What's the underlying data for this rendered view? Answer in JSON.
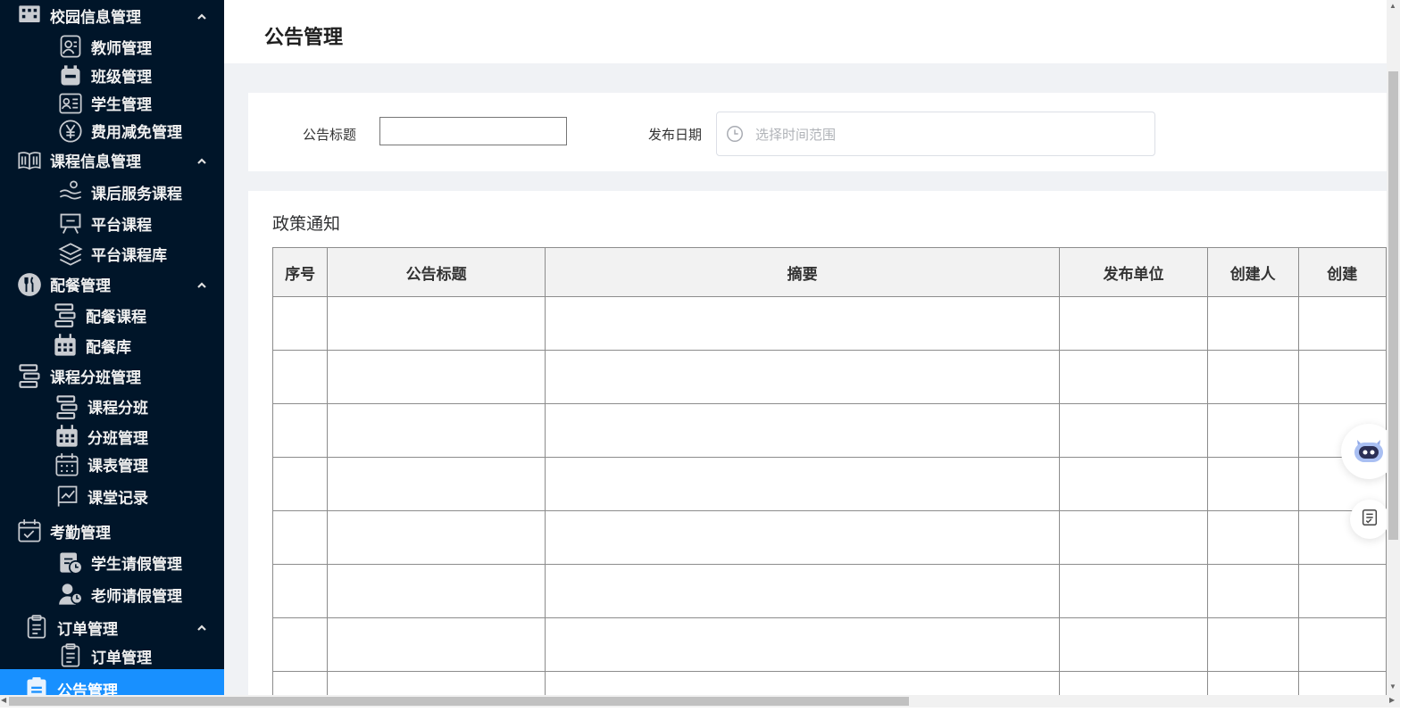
{
  "sidebar": {
    "items": [
      {
        "label": "校园信息管理",
        "icon": "building-icon",
        "level": 1,
        "expanded": true
      },
      {
        "label": "教师管理",
        "icon": "teacher-icon",
        "level": 2
      },
      {
        "label": "班级管理",
        "icon": "class-icon",
        "level": 2
      },
      {
        "label": "学生管理",
        "icon": "student-card-icon",
        "level": 2
      },
      {
        "label": "费用减免管理",
        "icon": "yen-coin-icon",
        "level": 2
      },
      {
        "label": "课程信息管理",
        "icon": "book-icon",
        "level": 1,
        "expanded": true
      },
      {
        "label": "课后服务课程",
        "icon": "service-icon",
        "level": 2
      },
      {
        "label": "平台课程",
        "icon": "presentation-icon",
        "level": 2
      },
      {
        "label": "平台课程库",
        "icon": "layers-icon",
        "level": 2
      },
      {
        "label": "配餐管理",
        "icon": "fork-knife-icon",
        "level": 1,
        "expanded": true
      },
      {
        "label": "配餐课程",
        "icon": "list-blocks-icon",
        "level": 2
      },
      {
        "label": "配餐库",
        "icon": "calendar-grid-icon",
        "level": 2
      },
      {
        "label": "课程分班管理",
        "icon": "list-blocks-icon",
        "level": 1
      },
      {
        "label": "课程分班",
        "icon": "list-blocks-icon",
        "level": 2
      },
      {
        "label": "分班管理",
        "icon": "calendar-grid-icon",
        "level": 2
      },
      {
        "label": "课表管理",
        "icon": "calendar-dots-icon",
        "level": 2
      },
      {
        "label": "课堂记录",
        "icon": "chart-board-icon",
        "level": 2
      },
      {
        "label": "考勤管理",
        "icon": "calendar-check-icon",
        "level": 1
      },
      {
        "label": "学生请假管理",
        "icon": "clipboard-clock-icon",
        "level": 2
      },
      {
        "label": "老师请假管理",
        "icon": "people-clock-icon",
        "level": 2
      },
      {
        "label": "订单管理",
        "icon": "clipboard-icon",
        "level": 1,
        "expanded": true
      },
      {
        "label": "订单管理",
        "icon": "clipboard-icon",
        "level": 2
      },
      {
        "label": "公告管理",
        "icon": "notice-icon",
        "level": 1,
        "active": true
      }
    ]
  },
  "page": {
    "title": "公告管理"
  },
  "filters": {
    "title_label": "公告标题",
    "title_value": "",
    "date_label": "发布日期",
    "date_placeholder": "选择时间范围"
  },
  "table": {
    "section_title": "政策通知",
    "columns": [
      "序号",
      "公告标题",
      "摘要",
      "发布单位",
      "创建人",
      "创建"
    ],
    "rows": [
      [
        "",
        "",
        "",
        "",
        "",
        ""
      ],
      [
        "",
        "",
        "",
        "",
        "",
        ""
      ],
      [
        "",
        "",
        "",
        "",
        "",
        ""
      ],
      [
        "",
        "",
        "",
        "",
        "",
        ""
      ],
      [
        "",
        "",
        "",
        "",
        "",
        ""
      ],
      [
        "",
        "",
        "",
        "",
        "",
        ""
      ],
      [
        "",
        "",
        "",
        "",
        "",
        ""
      ],
      [
        "",
        "",
        "",
        "",
        "",
        ""
      ]
    ]
  },
  "colors": {
    "sidebar_bg": "#001529",
    "active_item_bg": "#1890ff",
    "page_bg": "#f0f2f5"
  },
  "floating": {
    "assistant_icon": "robot-assistant-icon",
    "notes_icon": "checklist-icon"
  }
}
